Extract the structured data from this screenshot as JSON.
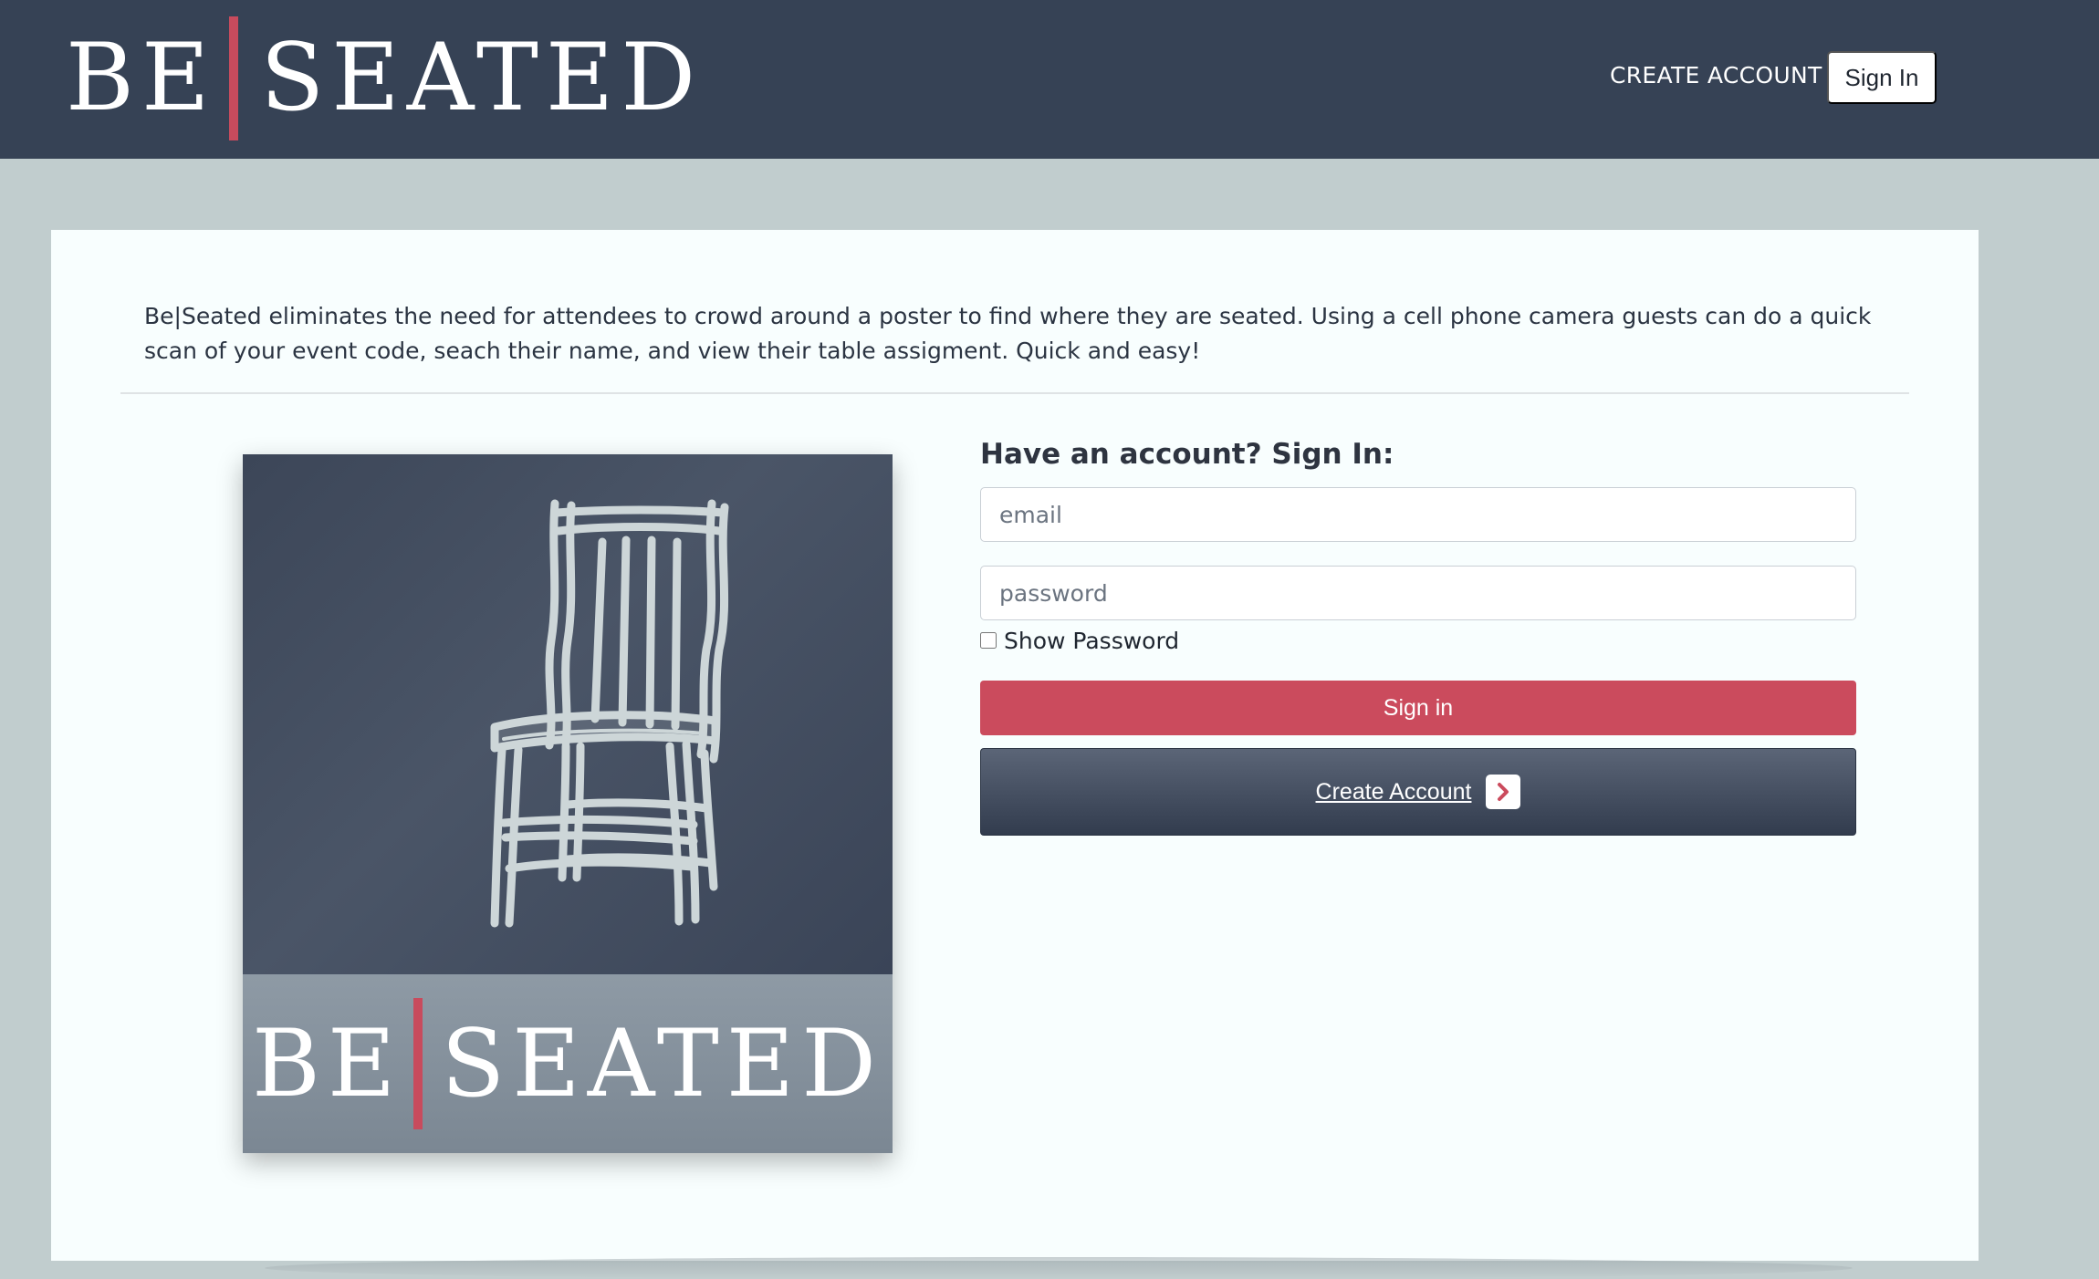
{
  "header": {
    "brand_left": "BE",
    "brand_right": "SEATED",
    "create_account_link": "CREATE ACCOUNT",
    "sign_in_button": "Sign In"
  },
  "intro": {
    "text": "Be|Seated eliminates the need for attendees to crowd around a poster to find where they are seated. Using a cell phone camera guests can do a quick scan of your event code, seach their name, and view their table assigment. Quick and easy!"
  },
  "logo_image": {
    "word_left": "BE",
    "word_right": "SEATED",
    "icon": "chair-icon"
  },
  "form": {
    "heading": "Have an account? Sign In:",
    "email_placeholder": "email",
    "password_placeholder": "password",
    "show_password_label": "Show Password",
    "show_password_checked": false,
    "sign_in_label": "Sign in",
    "create_account_label": "Create Account",
    "create_account_icon": "chevron-right-icon"
  },
  "colors": {
    "header_bg": "#364255",
    "page_bg": "#c1cdce",
    "card_bg": "#f8fefe",
    "accent_red": "#cb4b5d",
    "dark_button": "#3c4658"
  }
}
